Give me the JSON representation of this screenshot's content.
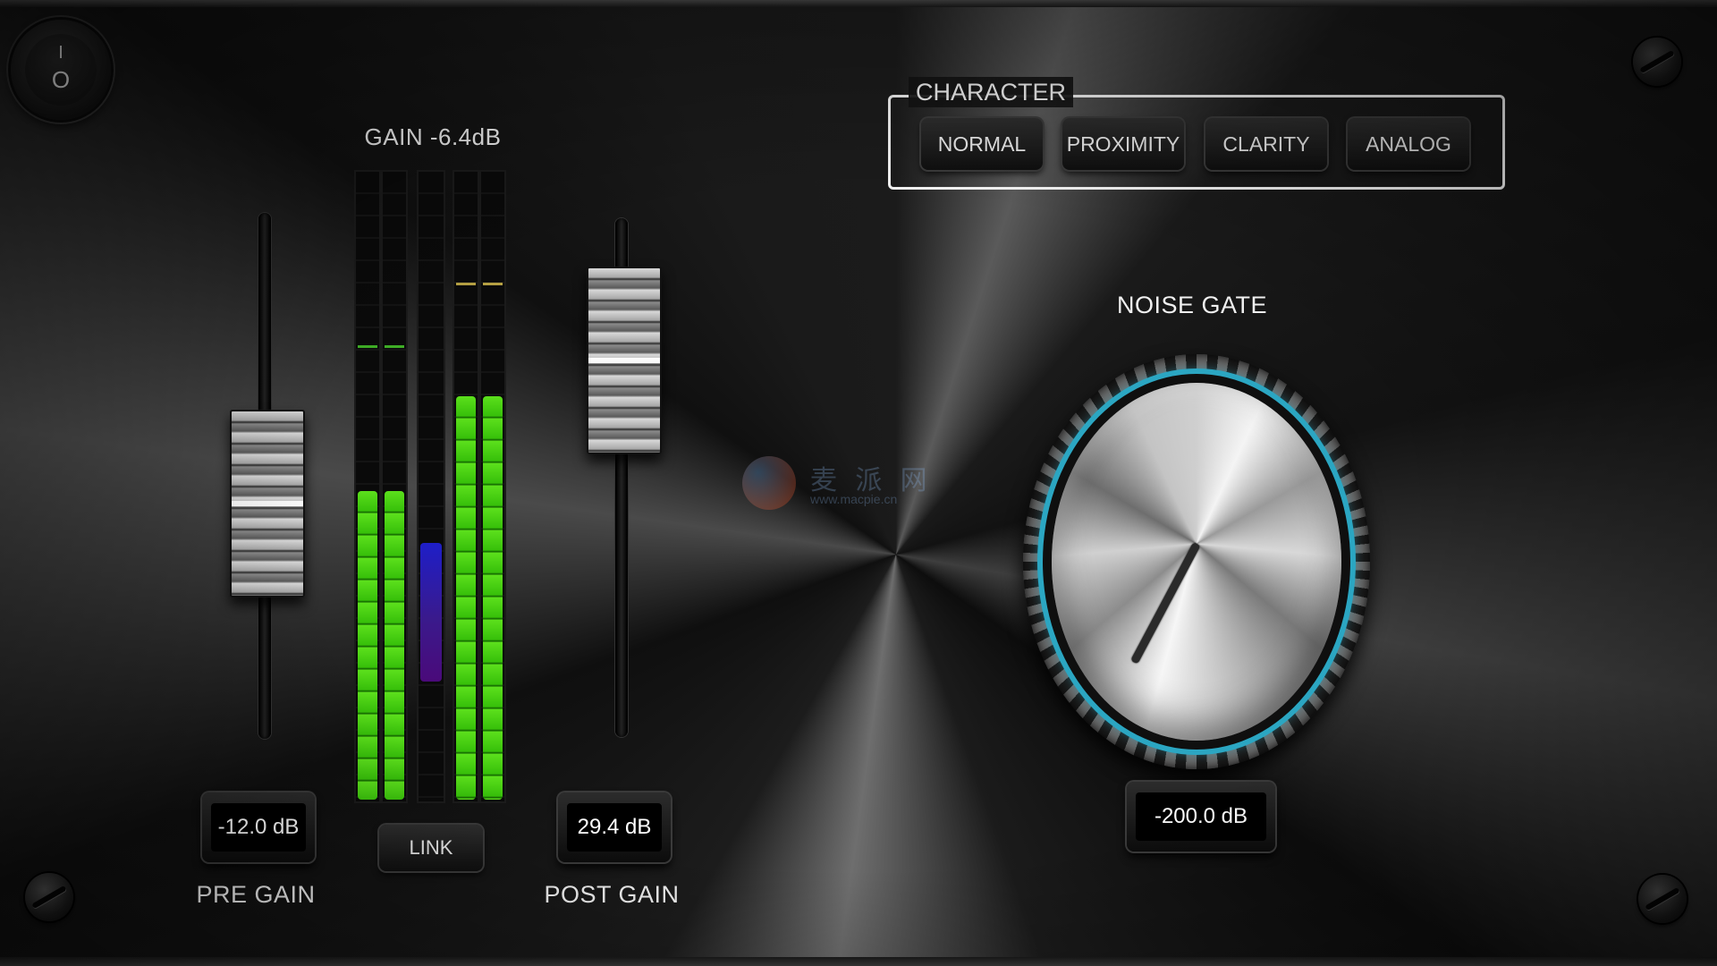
{
  "power": {
    "on_symbol": "I",
    "off_symbol": "O"
  },
  "character": {
    "title": "CHARACTER",
    "buttons": [
      {
        "label": "NORMAL"
      },
      {
        "label": "PROXIMITY"
      },
      {
        "label": "CLARITY"
      },
      {
        "label": "ANALOG"
      }
    ]
  },
  "gain": {
    "readout": "GAIN -6.4dB",
    "link_label": "LINK",
    "meters": {
      "in_left_level": 0.49,
      "in_right_level": 0.49,
      "in_peak": 0.72,
      "gain_reduction_top": 0.41,
      "gain_reduction_bottom": 0.19,
      "out_left_level": 0.64,
      "out_right_level": 0.64,
      "out_peak": 0.82,
      "colors": {
        "meter": "#37c00a",
        "peak_in": "#3fae26",
        "peak_out": "#b5a043",
        "reduction": "#2a1ab4"
      }
    }
  },
  "pre_gain": {
    "label": "PRE GAIN",
    "value": "-12.0 dB",
    "fader_level": 0.45
  },
  "post_gain": {
    "label": "POST GAIN",
    "value": "29.4 dB",
    "fader_level": 0.73
  },
  "noise_gate": {
    "label": "NOISE GATE",
    "value": "-200.0 dB",
    "knob_angle_deg": 208,
    "accent": "#2ba6c2"
  },
  "watermark": {
    "text": "麦 派 网",
    "url": "www.macpie.cn"
  }
}
